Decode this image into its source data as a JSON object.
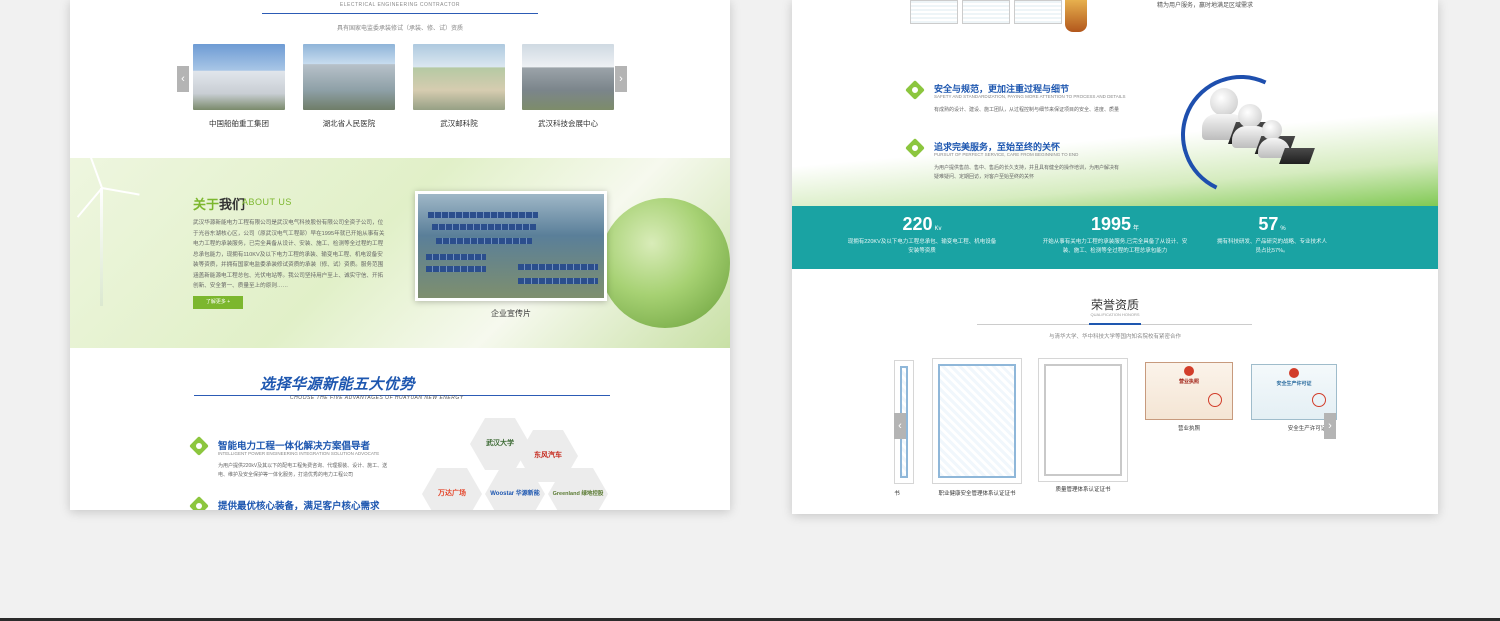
{
  "left": {
    "eng_title": "ELECTRICAL ENGINEERING CONTRACTOR",
    "intro_line": "具有国家电监委承装修试（承装、修、试）资质",
    "carousel": {
      "prev_icon": "‹",
      "next_icon": "›",
      "items": [
        {
          "caption": "中国船舶重工集团"
        },
        {
          "caption": "湖北省人民医院"
        },
        {
          "caption": "武汉邮科院"
        },
        {
          "caption": "武汉科技会展中心"
        }
      ]
    },
    "about": {
      "title_accent": "关于",
      "title_main": "我们",
      "title_en": "ABOUT US",
      "text": "武汉华源新能电力工程有限公司是武汉电气科技股份有限公司全资子公司，位于光谷东湖核心区，公司（原武汉电气工程部）早在1995年就已开始从事有关电力工程的承装服务，已完全具备从设计、安装、施工、检测等全过程的工程总承包能力，现拥有110KV及以下电力工程的承装、输变电工程、机电设备安装等资质，并拥有国家电监委承装修试资质的承装（修、试）资质。服务范围涵盖新能源电工程总包、光伏电站等。我公司坚持用户至上、诚实守信、开拓创新、安全第一、质量至上的原则……",
      "button": "了解更多 +",
      "video_caption": "企业宣传片"
    },
    "advantages": {
      "title": "选择华源新能五大优势",
      "subtitle": "CHOOSE THE FIVE ADVANTAGES OF HUAYUAN NEW ENERGY",
      "items": [
        {
          "head": "智能电力工程一体化解决方案倡导者",
          "en": "INTELLIGENT POWER ENGINEERING INTEGRATION SOLUTION ADVOCATE",
          "desc": "为用户提供220kV及其以下的配电工程免费咨询、代理报装、设计、施工、送电、维护及安全保护等一体化服务，打造优秀的电力工程公司"
        },
        {
          "head": "提供最优核心装备，满足客户核心需求",
          "en": "",
          "desc": ""
        }
      ],
      "partners": [
        "武汉大学",
        "东风汽车",
        "万达广场",
        "Woostar 华源新能",
        "Greenland 绿地控股"
      ]
    }
  },
  "right": {
    "top_text": "精为用户服务，赢时地满足区域需求",
    "services": [
      {
        "head": "安全与规范，更加注重过程与细节",
        "en": "SAFETY AND STANDARDIZATION, PAYING MORE ATTENTION TO PROCESS AND DETAILS",
        "desc": "有成熟的设计、建设、施工团队，从过程控制与细节来保证项目的安全、进度、质量"
      },
      {
        "head": "追求完美服务，至始至终的关怀",
        "en": "PURSUIT OF PERFECT SERVICE, CARE FROM BEGINNING TO END",
        "desc": "为用户提供售前、售中、售后的长久支持，并且具有健全的操作培训，为用户解决有疑难疑问、定期回访，对客户至始至终的关怀"
      }
    ],
    "stats": [
      {
        "num": "220",
        "unit": "Kv",
        "desc": "现拥有220KV及以下电力工程总承包、输变电工程、机电设备安装等资质"
      },
      {
        "num": "1995",
        "unit": "年",
        "desc": "开始从事有关电力工程的承装服务,已完全具备了从设计、安装、施工、检测等全过程的工程总承包能力"
      },
      {
        "num": "57",
        "unit": "%",
        "desc": "拥有科技研发、产品研究的战略、专业技术人员占比57%。"
      }
    ],
    "honors": {
      "title": "荣誉资质",
      "en": "QUALIFICATION HONORS",
      "intro": "与清华大学、华中科技大学等国内知名院校有紧密合作",
      "prev_icon": "‹",
      "next_icon": "›",
      "certs": [
        {
          "caption": "书"
        },
        {
          "caption": "职业健康安全管理体系认证证书"
        },
        {
          "caption": "质量管理体系认证证书"
        },
        {
          "caption": "营业执照",
          "license_head": "营业执照"
        },
        {
          "caption": "安全生产许可证",
          "license_head": "安全生产许可证"
        }
      ]
    }
  },
  "colors": {
    "brand_blue": "#1e57b0",
    "brand_green": "#7cb72e",
    "stats_teal": "#1aa3a3"
  }
}
